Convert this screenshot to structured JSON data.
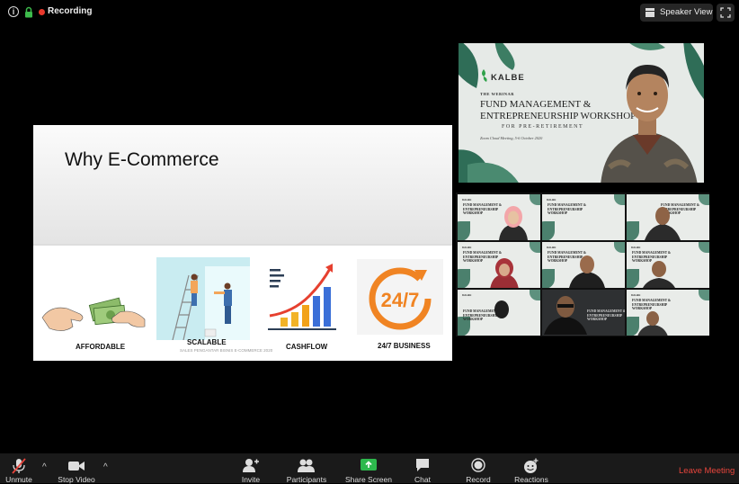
{
  "topbar": {
    "recording_label": "Recording",
    "speaker_view_label": "Speaker View",
    "recording_color": "#e8382c",
    "lock_color": "#3dbb4c"
  },
  "slide": {
    "title": "Why E-Commerce",
    "items": [
      {
        "label": "AFFORDABLE",
        "icon": "money-exchange-icon"
      },
      {
        "label": "SCALABLE",
        "icon": "painters-ladder-icon"
      },
      {
        "label": "CASHFLOW",
        "icon": "growth-chart-icon"
      },
      {
        "label": "24/7 BUSINESS",
        "icon": "clock-24-7-icon"
      }
    ],
    "clock_text": "24/7",
    "footer": "SALES PENGANTAR BISNIS E-COMMERCE 2020"
  },
  "speaker_video": {
    "logo": "KALBE",
    "kicker": "THE WEBINAR",
    "title_line1": "FUND MANAGEMENT &",
    "title_line2": "ENTREPRENEURSHIP WORKSHOP",
    "subtitle": "FOR PRE-RETIREMENT",
    "date": "Zoom Cloud Meeting, 5-6 October 2020"
  },
  "gallery": {
    "tile_title": "FUND MANAGEMENT & ENTREPRENEURSHIP WORKSHOP",
    "logo": "KALBE"
  },
  "controls": {
    "unmute": "Unmute",
    "stop_video": "Stop Video",
    "invite": "Invite",
    "participants": "Participants",
    "share_screen": "Share Screen",
    "chat": "Chat",
    "record": "Record",
    "reactions": "Reactions",
    "leave": "Leave Meeting",
    "share_color": "#2db84d",
    "leave_color": "#e8453c"
  }
}
